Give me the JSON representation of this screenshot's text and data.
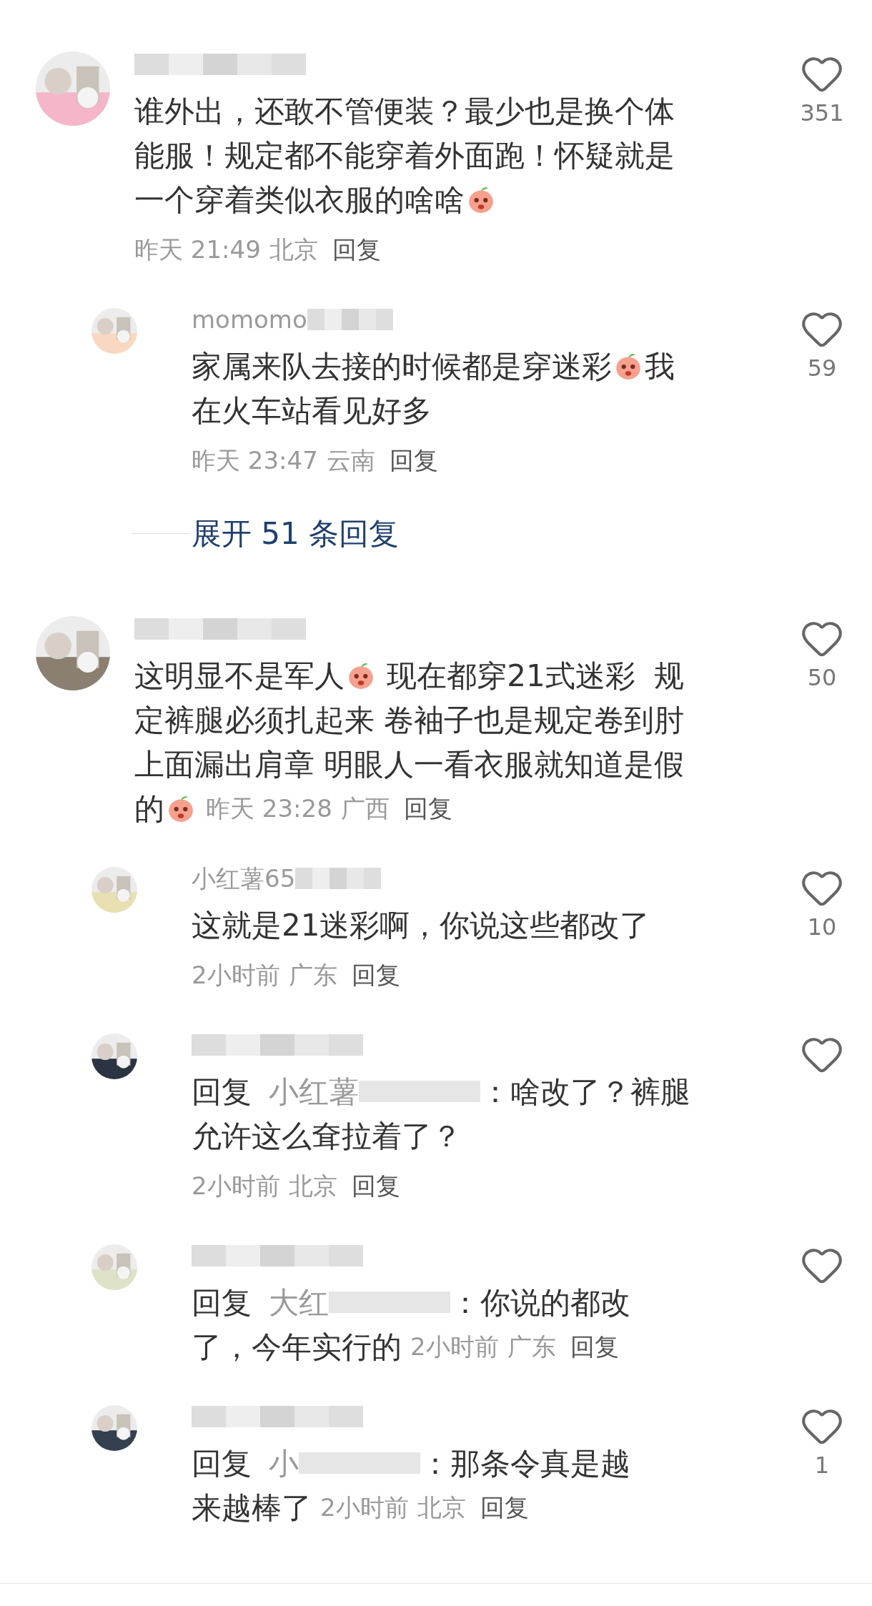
{
  "comments": [
    {
      "avatar": {
        "kind": "picture",
        "color": "#f4b6c8"
      },
      "lines": [
        [
          {
            "kind": "text",
            "text": "谁外出，还敢不管便装？最少也是换个体"
          }
        ],
        [
          {
            "kind": "text",
            "text": "能服！规定都不能穿着外面跑！怀疑就是"
          }
        ],
        [
          {
            "kind": "text",
            "text": "一个穿着类似衣服的啥啥"
          },
          {
            "kind": "emoji"
          }
        ]
      ],
      "meta_inline": false,
      "time": "昨天 21:49",
      "location": "北京",
      "reply_label": "回复",
      "likes": "351",
      "replies": [
        {
          "avatar": {
            "kind": "picture",
            "color": "#f8d8c0"
          },
          "name": "momomo",
          "lines": [
            [
              {
                "kind": "text",
                "text": "家属来队去接的时候都是穿迷彩"
              },
              {
                "kind": "emoji"
              },
              {
                "kind": "text",
                "text": "我"
              }
            ],
            [
              {
                "kind": "text",
                "text": "在火车站看见好多"
              }
            ]
          ],
          "meta_inline": false,
          "time": "昨天 23:47",
          "location": "云南",
          "reply_label": "回复",
          "likes": "59"
        }
      ],
      "expand": "展开 51 条回复"
    },
    {
      "avatar": {
        "kind": "picture",
        "color": "#8a7f70"
      },
      "lines": [
        [
          {
            "kind": "text",
            "text": "这明显不是军人"
          },
          {
            "kind": "emoji"
          },
          {
            "kind": "text",
            "text": " 现在都穿21式迷彩  规"
          }
        ],
        [
          {
            "kind": "text",
            "text": "定裤腿必须扎起来 卷袖子也是规定卷到肘"
          }
        ],
        [
          {
            "kind": "text",
            "text": "上面漏出肩章 明眼人一看衣服就知道是假"
          }
        ],
        [
          {
            "kind": "text",
            "text": "的"
          },
          {
            "kind": "emoji"
          }
        ]
      ],
      "meta_inline": true,
      "time": "昨天 23:28",
      "location": "广西",
      "reply_label": "回复",
      "likes": "50",
      "replies": [
        {
          "avatar": {
            "kind": "picture",
            "color": "#e8e0b0"
          },
          "name": "小红薯65",
          "lines": [
            [
              {
                "kind": "text",
                "text": "这就是21迷彩啊，你说这些都改了"
              }
            ]
          ],
          "meta_inline": false,
          "time": "2小时前",
          "location": "广东",
          "reply_label": "回复",
          "likes": "10"
        },
        {
          "avatar": {
            "kind": "picture",
            "color": "#2a3442"
          },
          "reply_to": {
            "label": "回复",
            "target": "小红薯"
          },
          "lines": [
            [
              {
                "kind": "text",
                "text": "：啥改了？裤腿"
              }
            ],
            [
              {
                "kind": "text",
                "text": "允许这么耷拉着了？"
              }
            ]
          ],
          "meta_inline": false,
          "time": "2小时前",
          "location": "北京",
          "reply_label": "回复"
        },
        {
          "avatar": {
            "kind": "picture",
            "color": "#dde2c8"
          },
          "reply_to": {
            "label": "回复",
            "target": "大红"
          },
          "lines": [
            [
              {
                "kind": "text",
                "text": "：你说的都改"
              }
            ],
            [
              {
                "kind": "text",
                "text": "了，今年实行的"
              }
            ]
          ],
          "meta_inline": true,
          "time": "2小时前",
          "location": "广东",
          "reply_label": "回复"
        },
        {
          "avatar": {
            "kind": "picture",
            "color": "#34404f"
          },
          "reply_to": {
            "label": "回复",
            "target": "小"
          },
          "lines": [
            [
              {
                "kind": "text",
                "text": "：那条令真是越"
              }
            ],
            [
              {
                "kind": "text",
                "text": "来越棒了"
              }
            ]
          ],
          "meta_inline": true,
          "time": "2小时前",
          "location": "北京",
          "reply_label": "回复",
          "likes": "1"
        }
      ]
    }
  ]
}
